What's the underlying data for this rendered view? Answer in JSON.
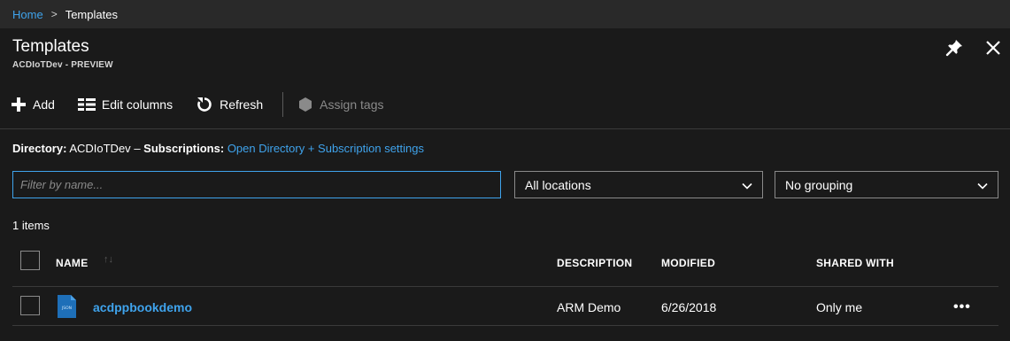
{
  "breadcrumb": {
    "home": "Home",
    "separator": ">",
    "current": "Templates"
  },
  "blade": {
    "title": "Templates",
    "subtitle": "ACDIoTDev - PREVIEW"
  },
  "toolbar": {
    "add": "Add",
    "edit_columns": "Edit columns",
    "refresh": "Refresh",
    "assign_tags": "Assign tags"
  },
  "directory": {
    "label": "Directory:",
    "name": "ACDIoTDev",
    "dash": "–",
    "subscriptions_label": "Subscriptions:",
    "settings_link": "Open Directory + Subscription settings"
  },
  "filters": {
    "name_placeholder": "Filter by name...",
    "locations": "All locations",
    "grouping": "No grouping"
  },
  "list": {
    "count": "1 items",
    "columns": {
      "name": "NAME",
      "description": "DESCRIPTION",
      "modified": "MODIFIED",
      "shared_with": "SHARED WITH"
    },
    "rows": [
      {
        "icon_label": "JSON",
        "name": "acdppbookdemo",
        "description": "ARM Demo",
        "modified": "6/26/2018",
        "shared_with": "Only me",
        "more": "•••"
      }
    ]
  },
  "colors": {
    "background": "#1a1a1a",
    "breadcrumb_bar": "#292929",
    "accent_link": "#3fa3ec",
    "border": "#8a8a8a",
    "divider": "#3a3a3a"
  },
  "icons": [
    "pin-icon",
    "close-icon",
    "plus-icon",
    "columns-icon",
    "refresh-icon",
    "tag-icon",
    "chevron-down-icon",
    "sort-icon",
    "json-file-icon",
    "more-icon"
  ]
}
